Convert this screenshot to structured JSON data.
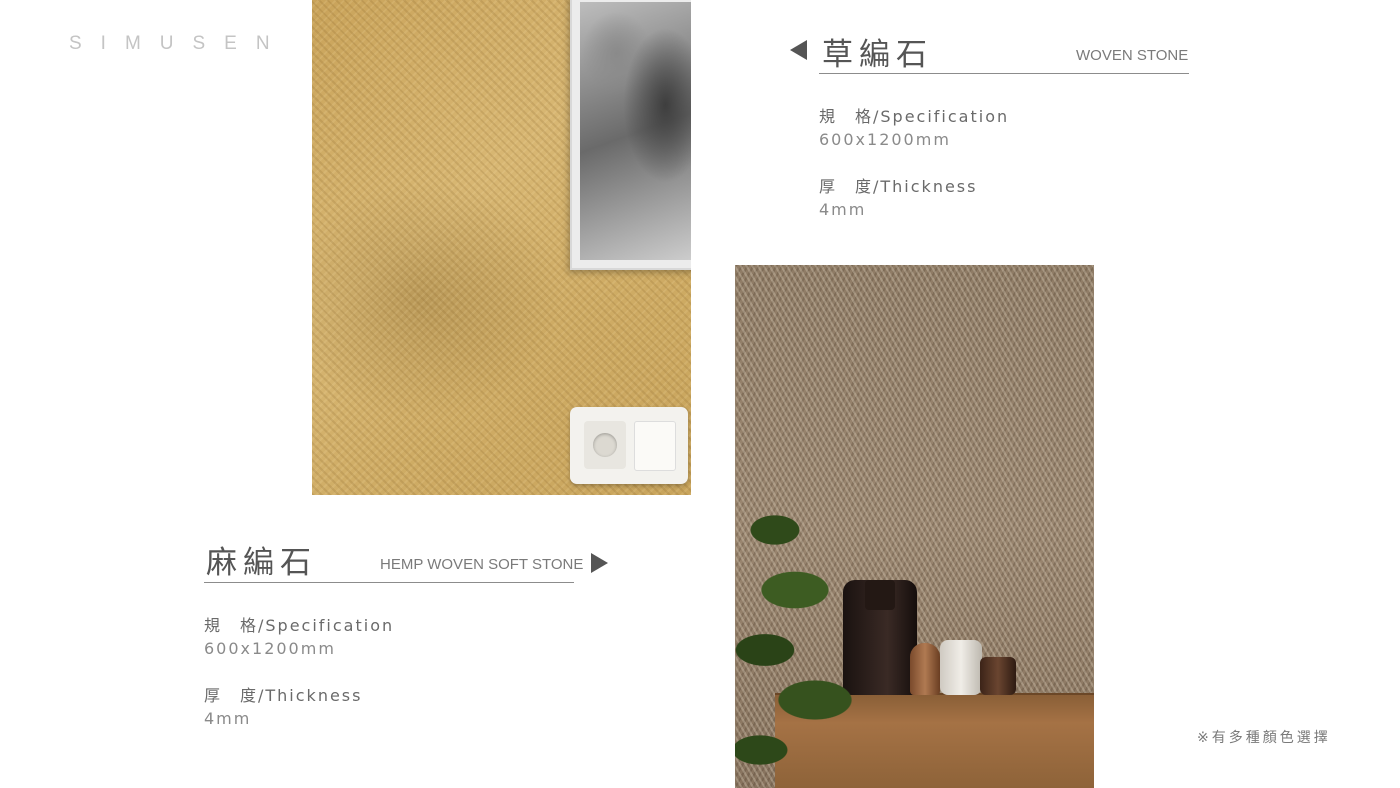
{
  "brand": "SIMUSEN",
  "products": {
    "woven_stone": {
      "name_zh": "草編石",
      "name_en": "WOVEN STONE",
      "spec_label": "規　格/Specification",
      "spec_value": "600x1200mm",
      "thickness_label": "厚　度/Thickness",
      "thickness_value": "4mm"
    },
    "hemp_woven": {
      "name_zh": "麻編石",
      "name_en": "HEMP WOVEN SOFT STONE",
      "spec_label": "規　格/Specification",
      "spec_value": "600x1200mm",
      "thickness_label": "厚　度/Thickness",
      "thickness_value": "4mm"
    }
  },
  "note": "※有多種顏色選擇",
  "colors": {
    "hemp_texture": "#d0ad66",
    "woven_texture": "#93806a",
    "text": "#555555",
    "brand": "#c4c4c4"
  }
}
